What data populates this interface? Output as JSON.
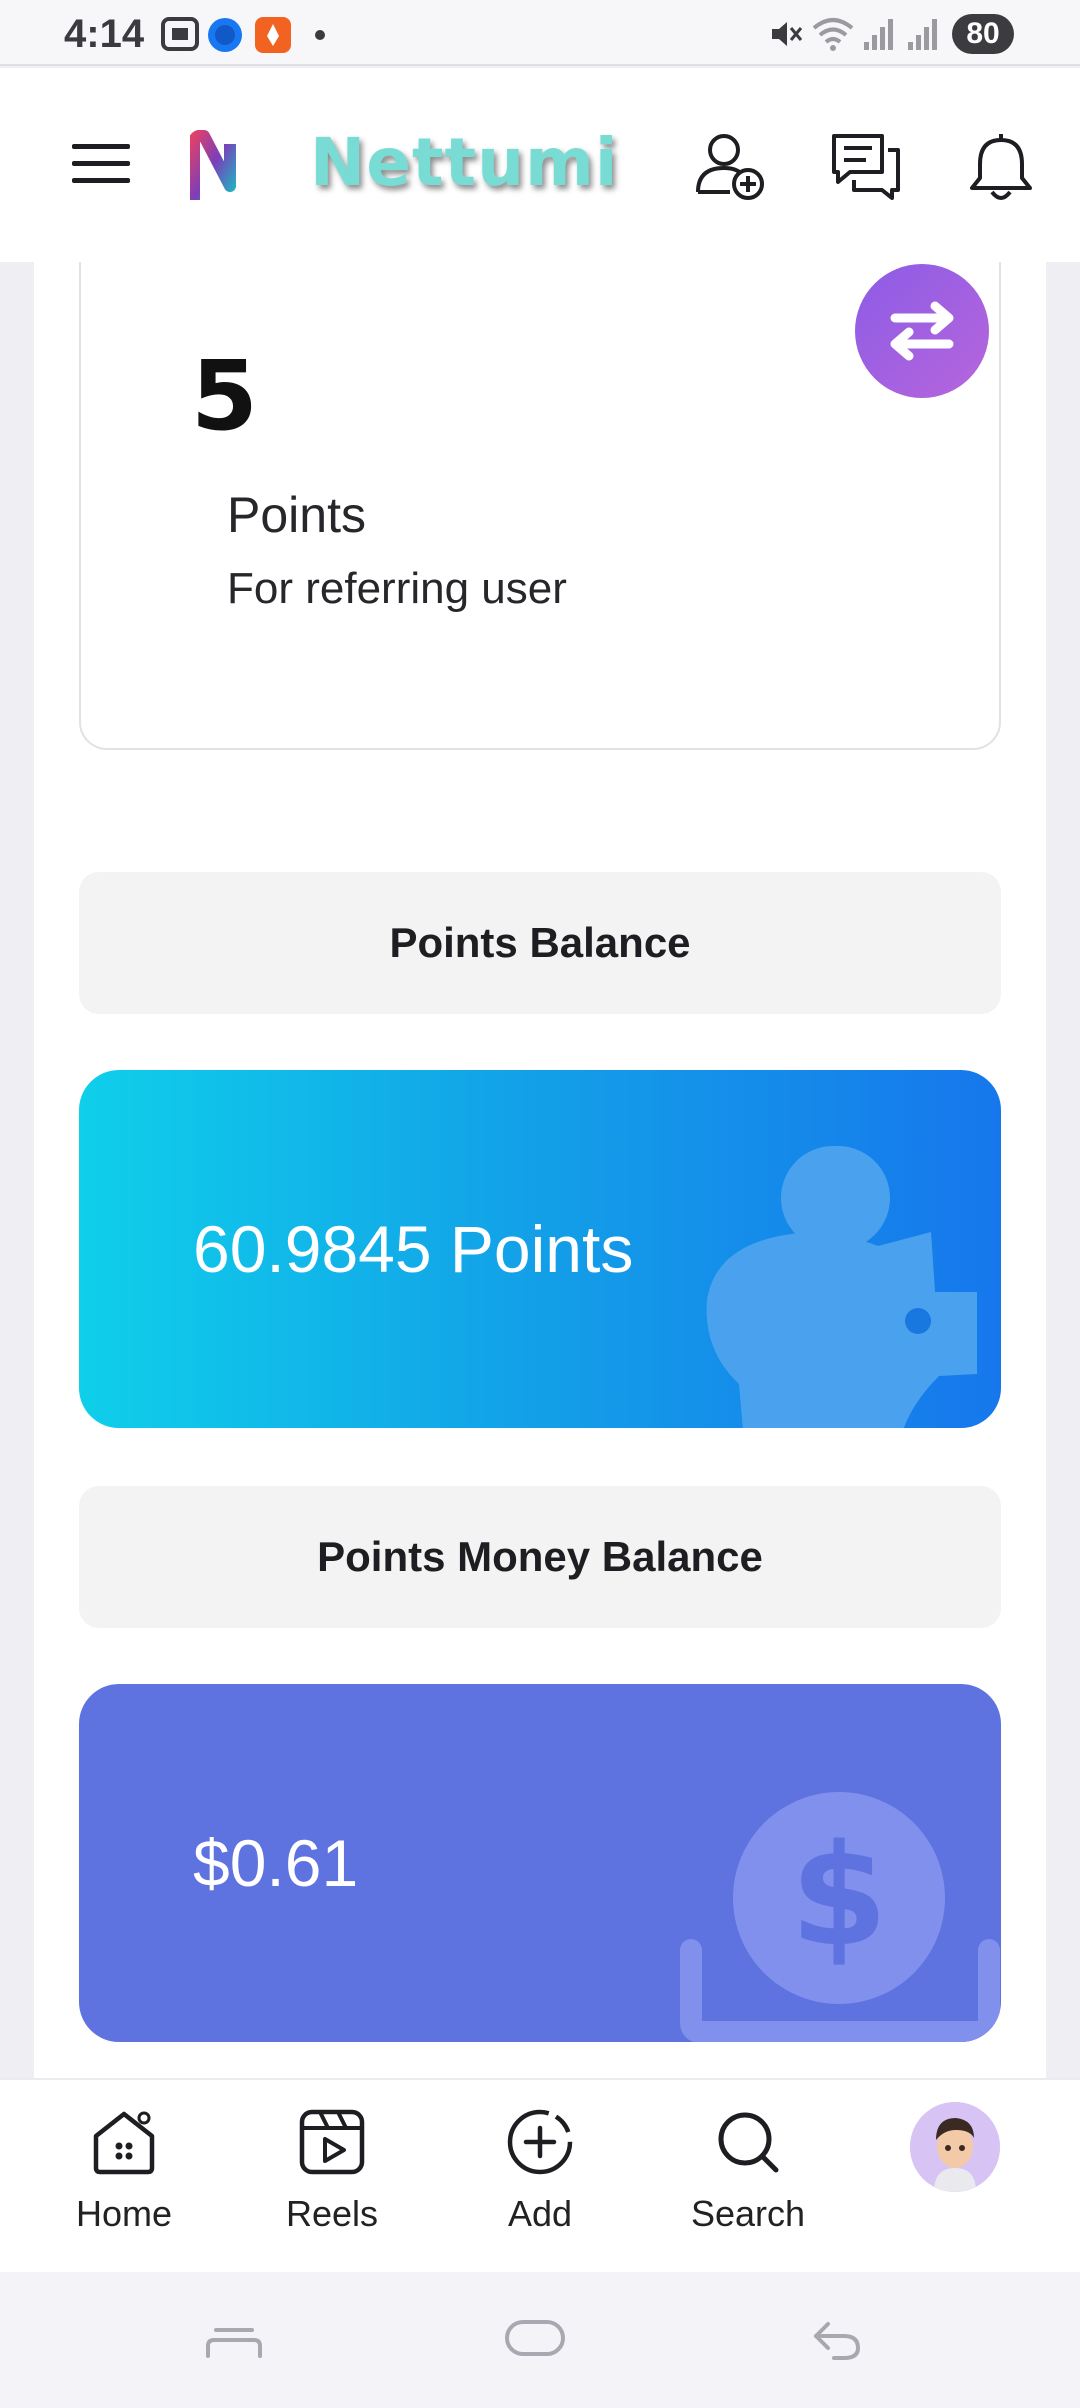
{
  "status_bar": {
    "time": "4:14",
    "battery": "80",
    "icons": [
      "screenshot-icon",
      "facebook-icon",
      "app-notification-icon",
      "dot-icon",
      "mute-icon",
      "wifi-icon",
      "signal-icon",
      "signal-icon-2"
    ]
  },
  "header": {
    "brand": "Nettumi",
    "icons": [
      "menu-icon",
      "logo-icon",
      "add-friend-icon",
      "messages-icon",
      "notifications-icon"
    ]
  },
  "referral": {
    "value": "5",
    "label": "Points",
    "description": "For referring user",
    "action_icon": "swap-icon"
  },
  "points_balance": {
    "title": "Points Balance",
    "value": "60.9845 Points",
    "icon": "piggy-bank-icon"
  },
  "money_balance": {
    "title": "Points Money Balance",
    "value": "$0.61",
    "icon": "dollar-coin-icon"
  },
  "bottom_nav": {
    "items": [
      {
        "label": "Home",
        "icon": "home-icon"
      },
      {
        "label": "Reels",
        "icon": "reels-icon"
      },
      {
        "label": "Add",
        "icon": "add-icon"
      },
      {
        "label": "Search",
        "icon": "search-icon"
      }
    ],
    "profile_icon": "avatar-icon"
  },
  "system_nav": [
    "recents-icon",
    "home-pill-icon",
    "back-icon"
  ],
  "colors": {
    "accent_purple": "#9b5fe0",
    "points_card_start": "#0fcfea",
    "points_card_end": "#1677ec",
    "money_card": "#5e72e0",
    "brand_text": "#78dcd4"
  }
}
